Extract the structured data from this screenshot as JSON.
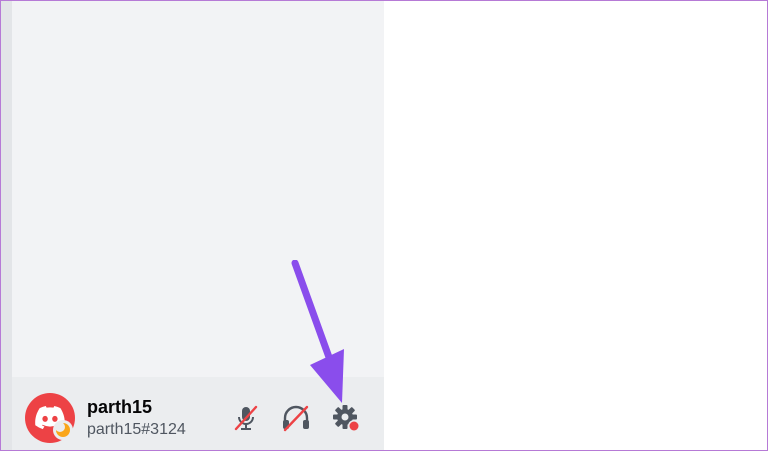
{
  "user": {
    "display_name": "parth15",
    "tag": "parth15#3124",
    "status": "idle"
  },
  "controls": {
    "mute_icon": "microphone-muted-icon",
    "deafen_icon": "headphones-deafened-icon",
    "settings_icon": "gear-icon",
    "settings_has_notification": true
  },
  "colors": {
    "avatar_bg": "#ed4245",
    "idle_status": "#faa61a",
    "muted_slash": "#ed4245",
    "notification_dot": "#ed4245",
    "annotation_arrow": "#8a4dec",
    "frame_border": "#b67ad6"
  }
}
